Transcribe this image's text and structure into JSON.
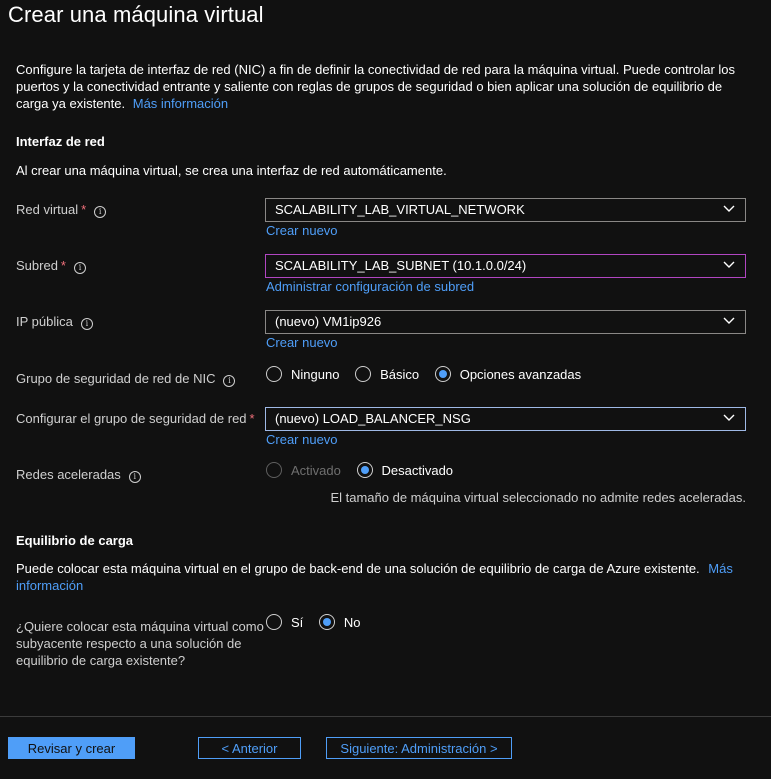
{
  "title": "Crear una máquina virtual",
  "intro": {
    "text": "Configure la tarjeta de interfaz de red (NIC) a fin de definir la conectividad de red para la máquina virtual. Puede controlar los puertos y la conectividad entrante y saliente con reglas de grupos de seguridad o bien aplicar una solución de equilibrio de carga ya existente.",
    "link": "Más información"
  },
  "network_interface": {
    "heading": "Interfaz de red",
    "description": "Al crear una máquina virtual, se crea una interfaz de red automáticamente.",
    "virtual_network": {
      "label": "Red virtual",
      "required": "*",
      "value": "SCALABILITY_LAB_VIRTUAL_NETWORK",
      "link": "Crear nuevo"
    },
    "subnet": {
      "label": "Subred",
      "required": "*",
      "value": "SCALABILITY_LAB_SUBNET (10.1.0.0/24)",
      "link": "Administrar configuración de subred"
    },
    "public_ip": {
      "label": "IP pública",
      "value": "(nuevo) VM1ip926",
      "link": "Crear nuevo"
    },
    "nic_nsg": {
      "label": "Grupo de seguridad de red de NIC",
      "options": [
        "Ninguno",
        "Básico",
        "Opciones avanzadas"
      ],
      "selected": "Opciones avanzadas"
    },
    "configure_nsg": {
      "label": "Configurar el grupo de seguridad de red",
      "required": "*",
      "value": "(nuevo) LOAD_BALANCER_NSG",
      "link": "Crear nuevo"
    },
    "accelerated_networking": {
      "label": "Redes aceleradas",
      "options": [
        "Activado",
        "Desactivado"
      ],
      "selected": "Desactivado",
      "note": "El tamaño de máquina virtual seleccionado no admite redes aceleradas."
    }
  },
  "load_balancing": {
    "heading": "Equilibrio de carga",
    "description": "Puede colocar esta máquina virtual en el grupo de back-end de una solución de equilibrio de carga de Azure existente.",
    "link_line1": "Más",
    "link_line2": "información",
    "question": "¿Quiere colocar esta máquina virtual como subyacente respecto a una solución de equilibrio de carga existente?",
    "options": [
      "Sí",
      "No"
    ],
    "selected": "No"
  },
  "footer": {
    "review_create": "Revisar y crear",
    "previous": "< Anterior",
    "next": "Siguiente: Administración >"
  },
  "colors": {
    "background": "#111111",
    "accent": "#4f9ef8",
    "required": "#f1707b",
    "subnet_border": "#b146c2"
  }
}
